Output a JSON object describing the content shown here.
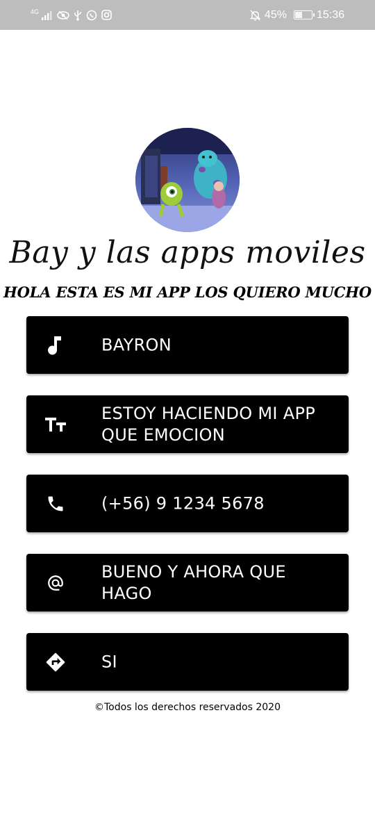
{
  "status_bar": {
    "network_label": "4G",
    "battery_percent": "45%",
    "battery_level": 0.45,
    "time": "15:36",
    "icons": [
      "signal-icon",
      "eye-icon",
      "usb-icon",
      "whatsapp-icon",
      "instagram-icon",
      "mute-icon",
      "battery-icon"
    ]
  },
  "profile": {
    "image": "monsters-inc-avatar",
    "title": "Bay y las apps moviles",
    "subtitle": "HOLA ESTA ES MI APP LOS QUIERO MUCHO"
  },
  "cards": [
    {
      "icon": "music-note-icon",
      "text": "BAYRON"
    },
    {
      "icon": "text-size-icon",
      "text": "ESTOY HACIENDO MI APP QUE EMOCION"
    },
    {
      "icon": "phone-icon",
      "text": "(+56) 9 1234 5678"
    },
    {
      "icon": "at-icon",
      "text": "BUENO Y AHORA QUE HAGO"
    },
    {
      "icon": "directions-icon",
      "text": "SI"
    }
  ],
  "footer": {
    "text": "©Todos los derechos reservados 2020"
  },
  "colors": {
    "card_background": "#000000",
    "status_bar_background": "#bdbdbd",
    "page_background": "#ffffff"
  }
}
